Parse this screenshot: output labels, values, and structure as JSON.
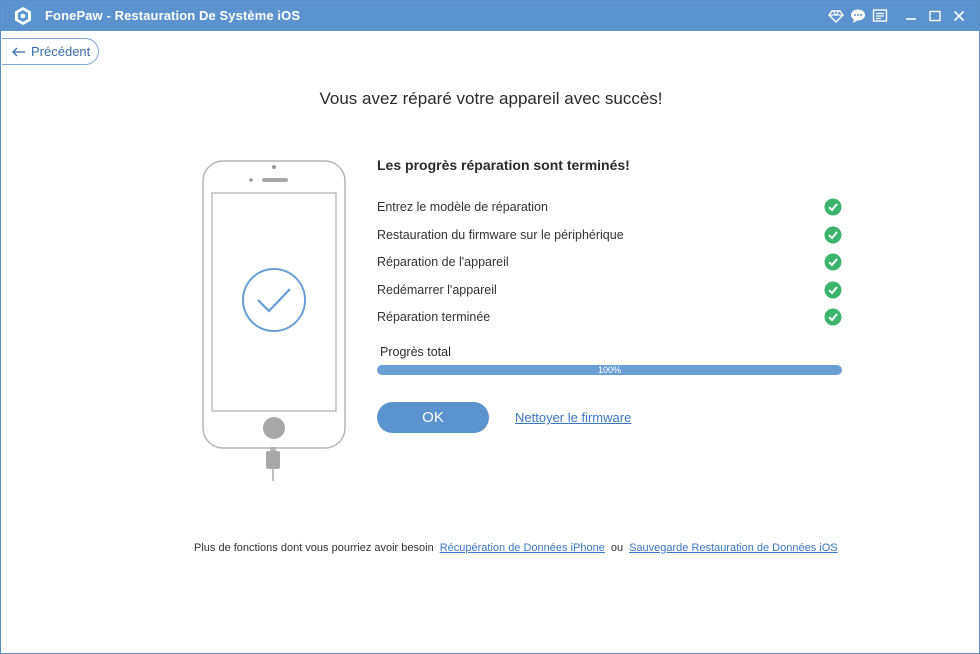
{
  "window": {
    "title": "FonePaw - Restauration De Système iOS",
    "accent_color": "#5b93cf"
  },
  "titlebar_icons": [
    "diamond-icon",
    "chat-icon",
    "feedback-icon",
    "minimize-icon",
    "maximize-icon",
    "close-icon"
  ],
  "nav": {
    "back_label": "Précédent"
  },
  "main": {
    "headline": "Vous avez réparé votre appareil avec succès!",
    "panel_title": "Les progrès réparation sont terminés!",
    "steps": [
      {
        "label": "Entrez le modèle de réparation",
        "status": "done"
      },
      {
        "label": "Restauration du firmware sur le périphérique",
        "status": "done"
      },
      {
        "label": "Réparation de l'appareil",
        "status": "done"
      },
      {
        "label": "Redémarrer l'appareil",
        "status": "done"
      },
      {
        "label": "Réparation terminée",
        "status": "done"
      }
    ],
    "total_label": "Progrès total",
    "progress_percent": 100,
    "progress_text": "100%",
    "ok_label": "OK",
    "clean_firmware_label": "Nettoyer le firmware",
    "success_color": "#3cb46e"
  },
  "footer": {
    "prefix": "Plus de fonctions dont vous pourriez avoir besoin",
    "link1": "Récupération de Données iPhone",
    "separator": "ou",
    "link2": "Sauvegarde  Restauration de Données iOS"
  }
}
